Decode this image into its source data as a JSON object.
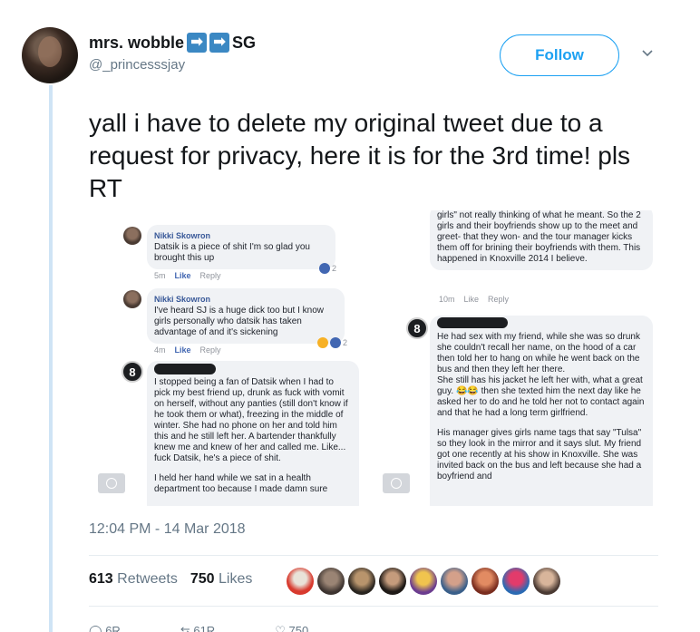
{
  "author": {
    "display_name": "mrs. wobble",
    "name_suffix": "SG",
    "name_emoji_1": "➡",
    "name_emoji_2": "➡",
    "handle": "@_princesssjay"
  },
  "follow_label": "Follow",
  "tweet_text": "yall i have to delete my original tweet due to a request for privacy, here it is for the 3rd time! pls RT",
  "media": {
    "left": {
      "c1_name": "Nikki Skowron",
      "c1_text": "Datsik is a piece of shit I'm so glad you brought this up",
      "c1_time": "5m",
      "c1_like": "Like",
      "c1_reply": "Reply",
      "c1_count": "2",
      "c2_name": "Nikki Skowron",
      "c2_text": "I've heard SJ is a huge dick too but I know girls personally who datsik has taken advantage of and it's sickening",
      "c2_time": "4m",
      "c2_like": "Like",
      "c2_reply": "Reply",
      "c2_count": "2",
      "c3_badge": "8",
      "c3_text": "I stopped being a fan of Datsik when I had to pick my best friend up, drunk as fuck with vomit on herself, without any panties (still don't know if he took them or what), freezing in the middle of winter. She had no phone on her and told him this and he still left her. A bartender thankfully knew me and knew of her and called me. Like... fuck Datsik, he's a piece of shit.",
      "c3_text2": "I held her hand while we sat in a health department too because I made damn sure"
    },
    "right": {
      "r1_text": "girls\" not really thinking of what he meant. So the 2 girls and their boyfriends show up to the meet and greet- that they won- and the tour manager kicks them off for brining their boyfriends with them. This happened in Knoxville 2014 I believe.",
      "r1_time": "10m",
      "r1_like": "Like",
      "r1_reply": "Reply",
      "r2_badge": "8",
      "r2_text": "He had sex with my friend, while she was so drunk she couldn't recall her name, on the hood of a car then told her to hang on while he went back on the bus and then they left her there.",
      "r2_text2": "She still has his jacket he left her with, what a great guy. 😂😂 then she texted him the next day like he asked her to do and he told her not to contact again and that he had a long term girlfriend.",
      "r2_text3": "His manager gives girls name tags that say \"Tulsa\" so they look in the mirror and it says slut. My friend got one recently at his show in Knoxville. She was invited back on the bus and left because she had a boyfriend and"
    }
  },
  "timestamp": "12:04 PM - 14 Mar 2018",
  "stats": {
    "retweets_count": "613",
    "retweets_label": "Retweets",
    "likes_count": "750",
    "likes_label": "Likes"
  },
  "actions": {
    "reply_count": "6R",
    "retweet_count": "61R",
    "like_count": "750"
  },
  "colors": {
    "accent": "#1da1f2",
    "thread_line": "#cfe4f5"
  }
}
